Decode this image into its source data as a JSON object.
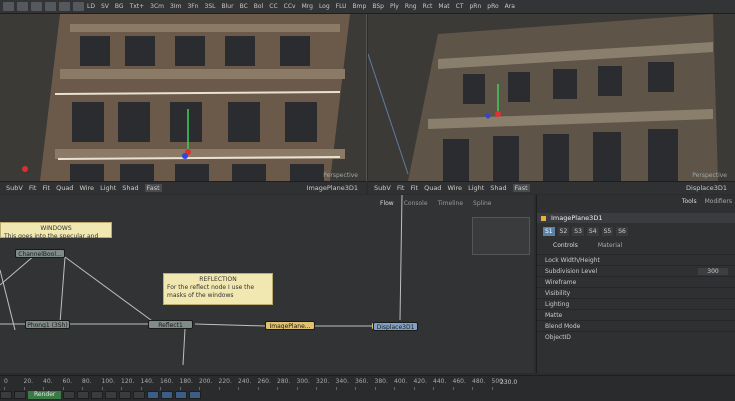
{
  "toolbar": {
    "tools": [
      "LD",
      "SV",
      "BG",
      "Txt+",
      "3Cm",
      "3Im",
      "3Fn",
      "3SL",
      "Blur",
      "BC",
      "Bol",
      "CC",
      "CCv",
      "Mrg",
      "Log",
      "FLU",
      "Bmp",
      "BSp",
      "Ply",
      "Rng",
      "Rct",
      "Mat",
      "CT",
      "pRn",
      "pRo",
      "Ara"
    ]
  },
  "viewer_left": {
    "label": "Perspective",
    "buttons": [
      "SubV",
      "Fit",
      "Fit",
      "Quad",
      "Wire",
      "Light",
      "Shad",
      "Fast"
    ],
    "name": "ImagePlane3D1"
  },
  "viewer_right": {
    "label": "Perspective",
    "buttons": [
      "SubV",
      "Fit",
      "Fit",
      "Quad",
      "Wire",
      "Light",
      "Shad",
      "Fast"
    ],
    "name": "Displace3D1"
  },
  "flow": {
    "tabs": [
      "Flow",
      "Console",
      "Timeline",
      "Spline"
    ],
    "notes": {
      "windows": {
        "title": "WINDOWS",
        "text": "This goes into the specular and"
      },
      "reflection": {
        "title": "REFLECTION",
        "text": "For the reflect node I use the masks of the windows"
      }
    },
    "nodes": {
      "channel": "ChannelBool...",
      "shader": "Phong1 (3Sh)",
      "reflect": "Reflect1",
      "imageplane": "ImagePlane...",
      "displace": "Displace3D1"
    }
  },
  "panel": {
    "tabs": [
      "Tools",
      "Modifiers"
    ],
    "node_title": "ImagePlane3D1",
    "slots": [
      "S1",
      "S2",
      "S3",
      "S4",
      "S5",
      "S6"
    ],
    "subtabs": [
      "Controls",
      "Material"
    ],
    "lock_label": "Lock Width/Height",
    "subdiv_label": "Subdivision Level",
    "subdiv_value": "300",
    "sections": [
      "Wireframe",
      "Visibility",
      "Lighting",
      "Matte",
      "Blend Mode",
      "ObjectID"
    ]
  },
  "timeline": {
    "ticks": [
      "0",
      "20.",
      "40.",
      "60.",
      "80.",
      "100.",
      "120.",
      "140.",
      "160.",
      "180.",
      "200.",
      "220.",
      "240.",
      "260.",
      "280.",
      "300.",
      "320.",
      "340.",
      "360.",
      "380.",
      "400.",
      "420.",
      "440.",
      "460.",
      "480.",
      "500."
    ],
    "end_value": "230.0",
    "render_label": "Render"
  }
}
